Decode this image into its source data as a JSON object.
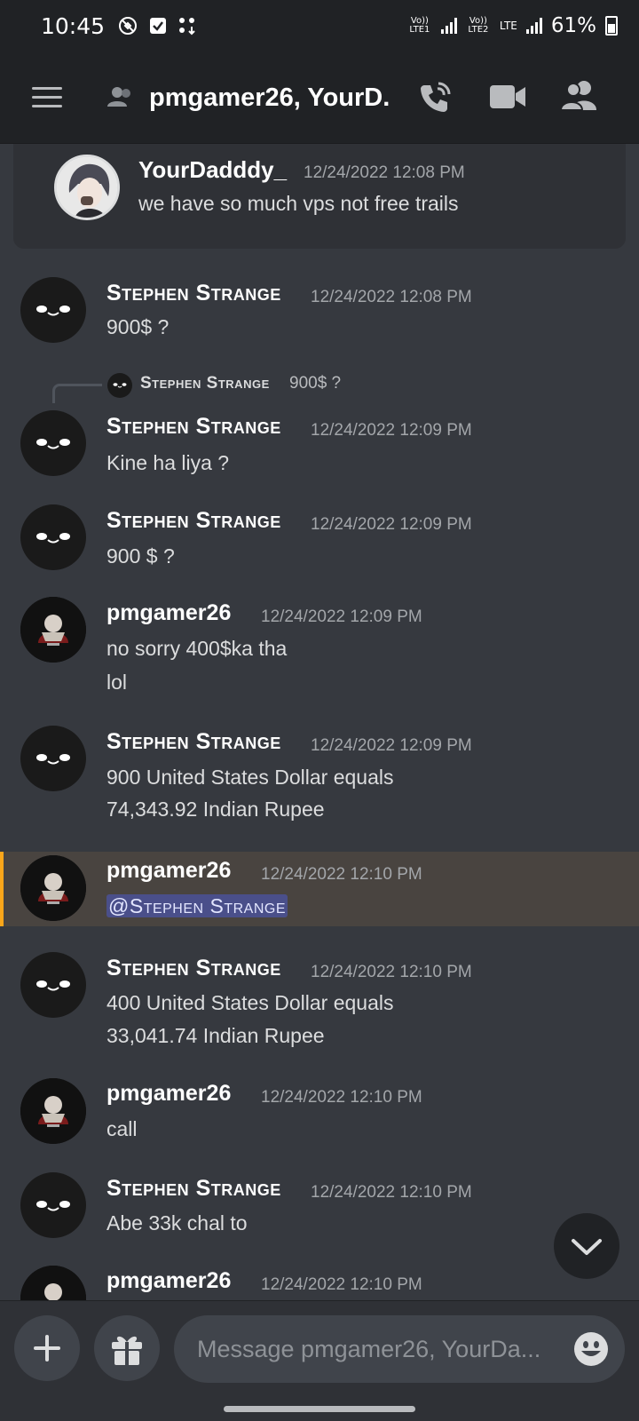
{
  "status_bar": {
    "time": "10:45",
    "sim1_label": "Vo)) LTE1",
    "sim2_label": "Vo)) LTE2",
    "network_type": "LTE",
    "battery": "61%"
  },
  "header": {
    "title": "pmgamer26, YourD..",
    "icons": [
      "menu-icon",
      "group-dm-icon",
      "voice-call-icon",
      "video-call-icon",
      "members-icon"
    ]
  },
  "context_message": {
    "username": "YourDadddy_",
    "timestamp": "12/24/2022 12:08 PM",
    "text": "we have so much vps not free trails"
  },
  "messages": [
    {
      "username": "Stephen Strange",
      "timestamp": "12/24/2022 12:08 PM",
      "lines": [
        "900$ ?"
      ]
    },
    {
      "reply_to": {
        "username": "Stephen Strange",
        "text": "900$ ?"
      },
      "username": "Stephen Strange",
      "timestamp": "12/24/2022 12:09 PM",
      "lines": [
        "Kine ha liya ?"
      ]
    },
    {
      "username": "Stephen Strange",
      "timestamp": "12/24/2022 12:09 PM",
      "lines": [
        "900 $ ?"
      ]
    },
    {
      "username": "pmgamer26",
      "timestamp": "12/24/2022 12:09 PM",
      "lines": [
        "no sorry 400$ka tha",
        "lol"
      ]
    },
    {
      "username": "Stephen Strange",
      "timestamp": "12/24/2022 12:09 PM",
      "lines": [
        "900 United States Dollar equals",
        "74,343.92 Indian Rupee"
      ]
    },
    {
      "username": "pmgamer26",
      "timestamp": "12/24/2022 12:10 PM",
      "mention": "@Stephen Strange",
      "highlighted": true
    },
    {
      "username": "Stephen Strange",
      "timestamp": "12/24/2022 12:10 PM",
      "lines": [
        "400 United States Dollar equals",
        "33,041.74 Indian Rupee"
      ]
    },
    {
      "username": "pmgamer26",
      "timestamp": "12/24/2022 12:10 PM",
      "lines": [
        "call"
      ]
    },
    {
      "username": "Stephen Strange",
      "timestamp": "12/24/2022 12:10 PM",
      "lines": [
        "Abe 33k chal to"
      ]
    },
    {
      "username": "pmgamer26",
      "timestamp": "12/24/2022 12:10 PM",
      "lines": []
    }
  ],
  "composer": {
    "placeholder": "Message pmgamer26, YourDa...",
    "icons": [
      "plus-icon",
      "gift-icon",
      "emoji-icon"
    ]
  },
  "colors": {
    "background": "#36393f",
    "header_background": "#202225",
    "mention_highlight": "#494440",
    "mention_bar": "#faa61a",
    "mention_pill": "#4a4f8a"
  }
}
